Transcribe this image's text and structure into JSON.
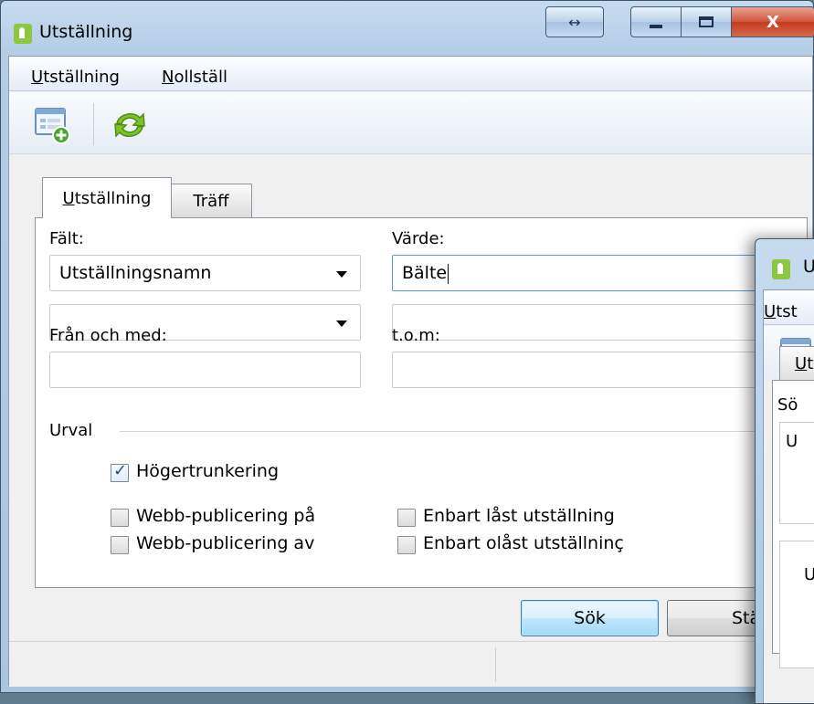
{
  "window": {
    "title": "Utställning",
    "caption_buttons": [
      "↔",
      "—",
      "□",
      "X"
    ]
  },
  "menu": {
    "items": [
      {
        "underline": "U",
        "rest": "tställning"
      },
      {
        "underline": "N",
        "rest": "ollställ"
      }
    ]
  },
  "toolbar": {
    "buttons": [
      "new-record-icon",
      "refresh-icon"
    ]
  },
  "tabs": [
    {
      "underline": "U",
      "rest": "tställning",
      "active": true
    },
    {
      "label": "Träff",
      "active": false
    }
  ],
  "form": {
    "field_label": "Fält:",
    "field_value": "Utställningsnamn",
    "field2_value": "",
    "value_label": "Värde:",
    "value_value": "Bälte",
    "value2_value": "",
    "from_label": "Från och med:",
    "from_value": "",
    "to_label": "t.o.m:",
    "to_value": ""
  },
  "selection": {
    "group_label": "Urval",
    "checkboxes": [
      {
        "label": "Högertrunkering",
        "checked": true
      },
      {
        "label": "Webb-publicering på",
        "checked": false
      },
      {
        "label": "Webb-publicering av",
        "checked": false
      },
      {
        "label": "Enbart låst utställning",
        "checked": false
      },
      {
        "label": "Enbart olåst utställninç",
        "checked": false
      }
    ]
  },
  "buttons": {
    "search": "Sök",
    "close": "Stäng"
  },
  "second_window": {
    "title": "U",
    "menu": {
      "underline": "U",
      "rest": "tst"
    },
    "tab": {
      "underline": "U",
      "rest": "t"
    },
    "label": "Sö",
    "list_item": "U",
    "grid_item": "U"
  },
  "colors": {
    "title_gradient_top": "#c6dbef",
    "title_gradient_bottom": "#a9c5e0",
    "close_button": "#c43a1f",
    "default_button": "#a7d9f5",
    "checkmark": "#1f4e98",
    "app_icon": "#8dc63f"
  }
}
